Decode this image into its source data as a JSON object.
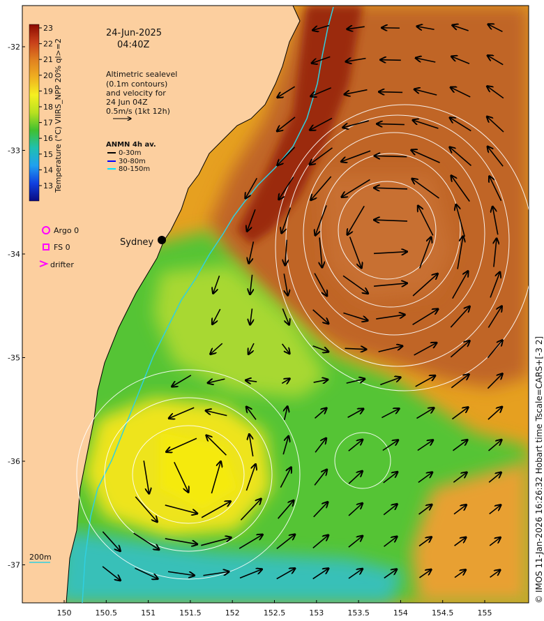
{
  "map": {
    "date": "24-Jun-2025",
    "time": "04:40Z",
    "colorbar": {
      "label": "Temperature (°C) VIIRS_NPP 20% ql>=2",
      "ticks": [
        "23",
        "22",
        "21",
        "20",
        "19",
        "18",
        "17",
        "16",
        "15",
        "14",
        "13"
      ]
    },
    "altimetry_note": [
      "Altimetric sealevel",
      "(0.1m contours)",
      "and velocity for",
      "24 Jun 04Z",
      "0.5m/s (1kt 12h)"
    ],
    "anmn": {
      "title": "ANMN 4h av.",
      "items": [
        {
          "label": "0-30m",
          "color": "#000000"
        },
        {
          "label": "30-80m",
          "color": "#0000ff"
        },
        {
          "label": "80-150m",
          "color": "#00e5ff"
        }
      ]
    },
    "platforms": [
      {
        "label": "Argo 0",
        "color": "#ff00ff"
      },
      {
        "label": "FS 0",
        "color": "#ff00ff"
      },
      {
        "label": "drifter",
        "color": "#ff00ff"
      }
    ],
    "city": "Sydney",
    "isobath_label": "200m",
    "credit": "© IMOS 11-Jan-2026 16:26:32 Hobart time Tscale=CARS+[-3 2]",
    "x_ticks": [
      "150",
      "150.5",
      "151",
      "151.5",
      "152",
      "152.5",
      "153",
      "153.5",
      "154",
      "154.5",
      "155"
    ],
    "y_ticks": [
      "-32",
      "-33",
      "-34",
      "-35",
      "-36",
      "-37"
    ],
    "colors": {
      "land": "#fccf9f",
      "warm": "#b5501e",
      "mid": "#e8a020",
      "yellow": "#f0e010",
      "green": "#40c030",
      "cyan": "#30c0c0"
    }
  }
}
